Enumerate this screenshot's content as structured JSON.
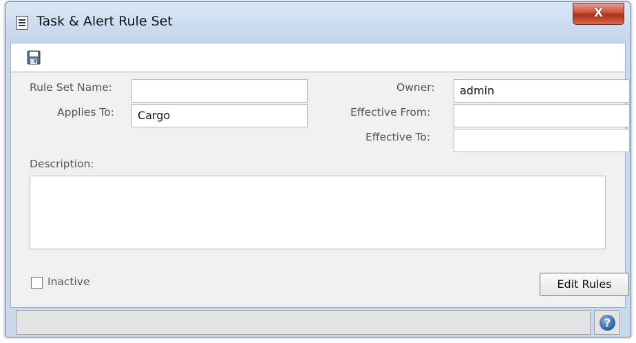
{
  "window": {
    "title": "Task & Alert Rule Set",
    "close_label": "X"
  },
  "toolbar": {
    "save_icon": "save-icon"
  },
  "form": {
    "rule_set_name": {
      "label": "Rule Set Name:",
      "value": ""
    },
    "applies_to": {
      "label": "Applies To:",
      "value": "Cargo"
    },
    "owner": {
      "label": "Owner:",
      "value": "admin"
    },
    "effective_from": {
      "label": "Effective From:",
      "value": ""
    },
    "effective_to": {
      "label": "Effective To:",
      "value": ""
    },
    "description": {
      "label": "Description:",
      "value": ""
    },
    "inactive": {
      "label": "Inactive",
      "checked": false
    },
    "edit_rules_label": "Edit Rules"
  },
  "statusbar": {
    "text": "",
    "help_label": "?"
  },
  "colors": {
    "window_frame": "#c9d9ec",
    "close_button": "#c74a33",
    "form_background": "#f0f0f0"
  }
}
